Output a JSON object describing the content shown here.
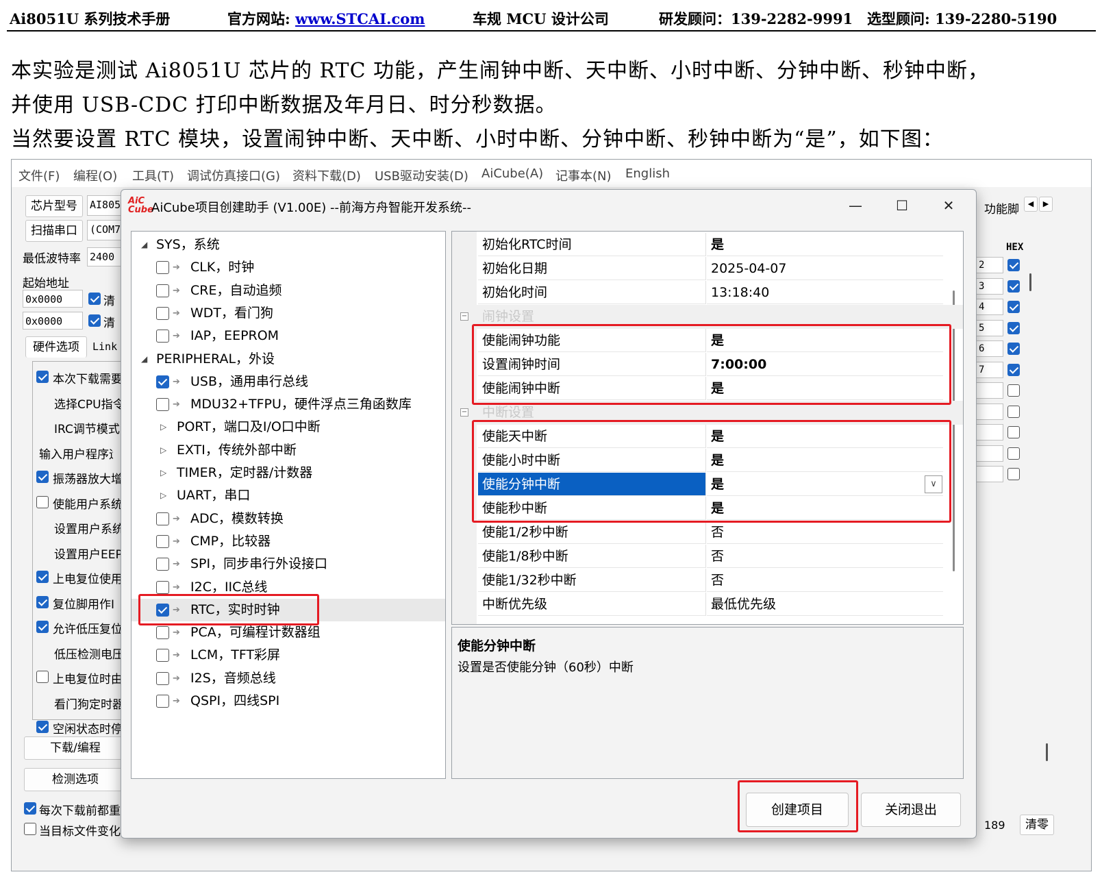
{
  "doc_header": {
    "manual": "Ai8051U 系列技术手册",
    "site_label": "官方网站: ",
    "site_url": "www.STCAI.com",
    "company": "车规 MCU 设计公司",
    "rd_contact": "研发顾问：139-2282-9991",
    "selection_contact": "选型顾问: 139-2280-5190"
  },
  "paragraphs": [
    "本实验是测试 Ai8051U 芯片的 RTC 功能，产生闹钟中断、天中断、小时中断、分钟中断、秒钟中断，",
    "并使用 USB-CDC 打印中断数据及年月日、时分秒数据。",
    "当然要设置 RTC 模块，设置闹钟中断、天中断、小时中断、分钟中断、秒钟中断为“是”，如下图："
  ],
  "menu": [
    "文件(F)",
    "编程(O)",
    "工具(T)",
    "调试仿真接口(G)",
    "资料下载(D)",
    "USB驱动安装(D)",
    "AiCube(A)",
    "记事本(N)",
    "English"
  ],
  "left_panel": {
    "chip_btn": "芯片型号",
    "chip_value": "AI805",
    "scan_btn": "扫描串口",
    "port_value": "(COM7",
    "baud_label": "最低波特率",
    "baud_value": "2400",
    "start_addr_label": "起始地址",
    "addr1": "0x0000",
    "addr2": "0x0000",
    "clear1": "清",
    "clear2": "清",
    "tab_hw": "硬件选项",
    "tab_link": "Link",
    "options": [
      {
        "text": "本次下载需要",
        "checked": true
      },
      {
        "text": "选择CPU指令",
        "checked": null
      },
      {
        "text": "IRC调节模式",
        "checked": null
      },
      {
        "text": "输入用户程序运",
        "checked": null
      },
      {
        "text": "振荡器放大增",
        "checked": true
      },
      {
        "text": "使能用户系统",
        "checked": false
      },
      {
        "text": "设置用户系统",
        "checked": null
      },
      {
        "text": "设置用户EEP",
        "checked": null
      },
      {
        "text": "上电复位使用",
        "checked": true
      },
      {
        "text": "复位脚用作I",
        "checked": true
      },
      {
        "text": "允许低压复位",
        "checked": true
      },
      {
        "text": "低压检测电压",
        "checked": null
      },
      {
        "text": "上电复位时由",
        "checked": false
      },
      {
        "text": "看门狗定时器",
        "checked": null
      },
      {
        "text": "空闲状态时停",
        "checked": true
      }
    ],
    "download_btn": "下载/编程",
    "check_btn": "检测选项",
    "every_download": "每次下载前都重",
    "when_target": "当目标文件变化"
  },
  "right_panel": {
    "tab": "功能脚",
    "hex_label": "HEX",
    "rows": [
      {
        "num": "2",
        "checked": true
      },
      {
        "num": "3",
        "checked": true
      },
      {
        "num": "4",
        "checked": true
      },
      {
        "num": "5",
        "checked": true
      },
      {
        "num": "6",
        "checked": true
      },
      {
        "num": "7",
        "checked": true
      },
      {
        "num": "",
        "checked": false
      },
      {
        "num": "",
        "checked": false
      },
      {
        "num": "",
        "checked": false
      },
      {
        "num": "",
        "checked": false
      },
      {
        "num": "",
        "checked": false
      }
    ],
    "counter": "189",
    "clear_btn": "清零"
  },
  "dialog": {
    "icon_text": "AiC Cube",
    "title": "AiCube项目创建助手 (V1.00E) --前海方舟智能开发系统--",
    "minimize": "—",
    "maximize": "☐",
    "close": "✕",
    "tree": [
      {
        "text": "SYS，系统",
        "kind": "expanded",
        "checked": null
      },
      {
        "text": "CLK，时钟",
        "kind": "leaf",
        "checked": false
      },
      {
        "text": "CRE，自动追频",
        "kind": "leaf",
        "checked": false
      },
      {
        "text": "WDT，看门狗",
        "kind": "leaf",
        "checked": false
      },
      {
        "text": "IAP，EEPROM",
        "kind": "leaf",
        "checked": false
      },
      {
        "text": "PERIPHERAL，外设",
        "kind": "expanded",
        "checked": null
      },
      {
        "text": "USB，通用串行总线",
        "kind": "leaf",
        "checked": true
      },
      {
        "text": "MDU32+TFPU，硬件浮点三角函数库",
        "kind": "leaf",
        "checked": false
      },
      {
        "text": "PORT，端口及I/O口中断",
        "kind": "collapsed",
        "checked": null
      },
      {
        "text": "EXTI，传统外部中断",
        "kind": "collapsed",
        "checked": null
      },
      {
        "text": "TIMER，定时器/计数器",
        "kind": "collapsed",
        "checked": null
      },
      {
        "text": "UART，串口",
        "kind": "collapsed",
        "checked": null
      },
      {
        "text": "ADC，模数转换",
        "kind": "leaf",
        "checked": false
      },
      {
        "text": "CMP，比较器",
        "kind": "leaf",
        "checked": false
      },
      {
        "text": "SPI，同步串行外设接口",
        "kind": "leaf",
        "checked": false
      },
      {
        "text": "I2C，IIC总线",
        "kind": "leaf",
        "checked": false
      },
      {
        "text": "RTC，实时时钟",
        "kind": "leaf",
        "checked": true
      },
      {
        "text": "PCA，可编程计数器组",
        "kind": "leaf",
        "checked": false
      },
      {
        "text": "LCM，TFT彩屏",
        "kind": "leaf",
        "checked": false
      },
      {
        "text": "I2S，音频总线",
        "kind": "leaf",
        "checked": false
      },
      {
        "text": "QSPI，四线SPI",
        "kind": "leaf",
        "checked": false
      }
    ],
    "props": [
      {
        "type": "row",
        "name": "初始化RTC时间",
        "value": "是"
      },
      {
        "type": "row",
        "name": "初始化日期",
        "value": "2025-04-07"
      },
      {
        "type": "row",
        "name": "初始化时间",
        "value": "13:18:40"
      },
      {
        "type": "group",
        "name": "闹钟设置"
      },
      {
        "type": "row",
        "name": "使能闹钟功能",
        "value": "是"
      },
      {
        "type": "row",
        "name": "设置闹钟时间",
        "value": "7:00:00",
        "bold": true
      },
      {
        "type": "row",
        "name": "使能闹钟中断",
        "value": "是"
      },
      {
        "type": "group",
        "name": "中断设置"
      },
      {
        "type": "row",
        "name": "使能天中断",
        "value": "是"
      },
      {
        "type": "row",
        "name": "使能小时中断",
        "value": "是"
      },
      {
        "type": "row",
        "name": "使能分钟中断",
        "value": "是",
        "selected": true
      },
      {
        "type": "row",
        "name": "使能秒中断",
        "value": "是"
      },
      {
        "type": "row",
        "name": "使能1/2秒中断",
        "value": "否"
      },
      {
        "type": "row",
        "name": "使能1/8秒中断",
        "value": "否"
      },
      {
        "type": "row",
        "name": "使能1/32秒中断",
        "value": "否"
      },
      {
        "type": "row",
        "name": "中断优先级",
        "value": "最低优先级"
      }
    ],
    "desc_title": "使能分钟中断",
    "desc_text": "设置是否使能分钟（60秒）中断",
    "create_btn": "创建项目",
    "exit_btn": "关闭退出"
  },
  "colors": {
    "highlight_box": "#e51b23",
    "selection": "#0a60c2",
    "checkbox": "#1e66c6"
  }
}
